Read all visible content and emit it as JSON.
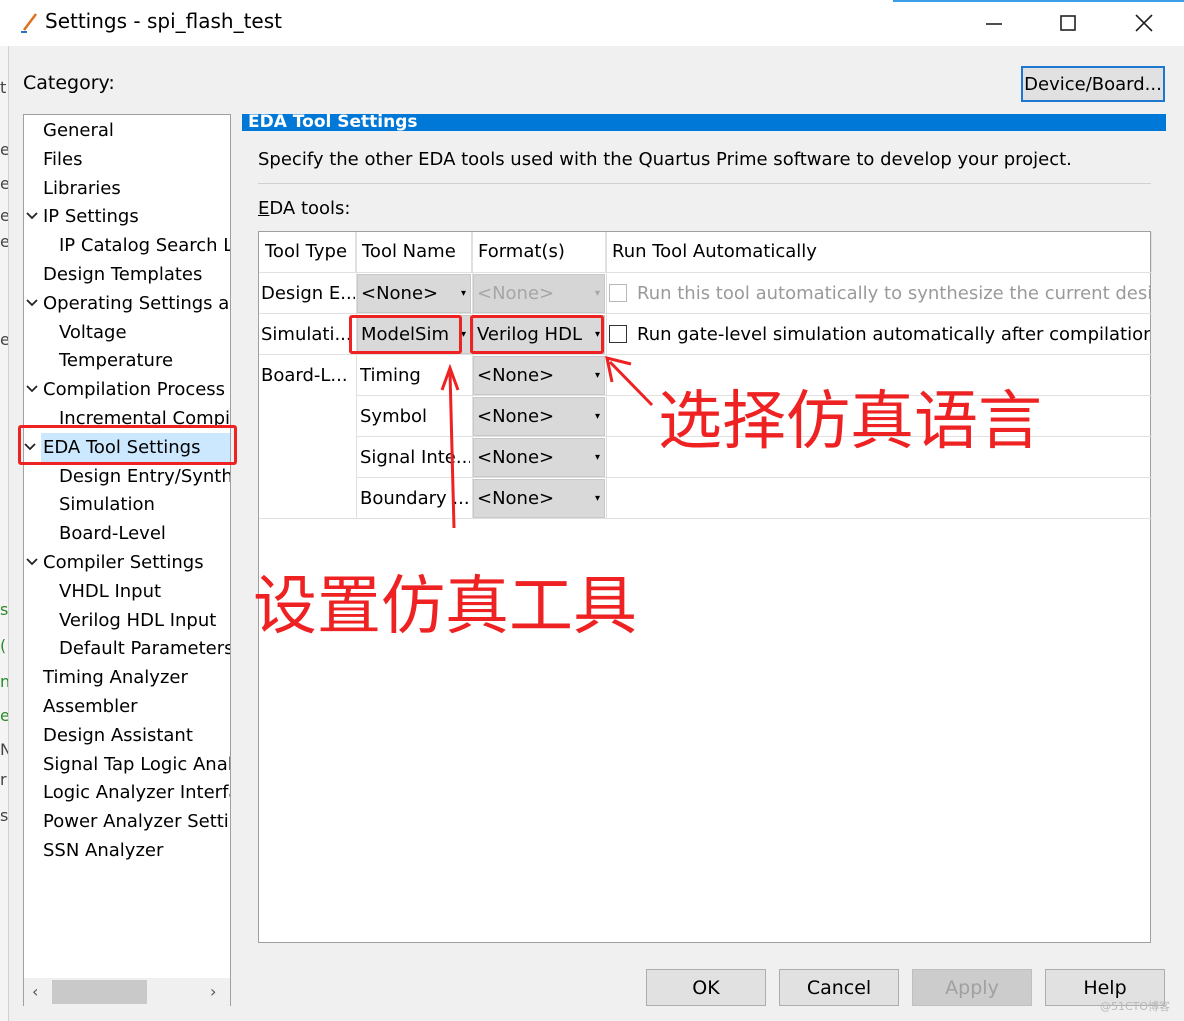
{
  "window": {
    "title": "Settings - spi_flash_test",
    "controls": [
      "minimize-icon",
      "maximize-icon",
      "close-icon"
    ]
  },
  "left_strip_chars": [
    "t",
    "e",
    "e",
    "e",
    "e",
    "e",
    "s",
    "(",
    "n",
    "e",
    "N",
    "r",
    "s"
  ],
  "category_label": "Category:",
  "device_button": "Device/Board...",
  "tree": {
    "items": [
      {
        "label": "General",
        "level": 0
      },
      {
        "label": "Files",
        "level": 0
      },
      {
        "label": "Libraries",
        "level": 0
      },
      {
        "label": "IP Settings",
        "level": 0,
        "expanded": true
      },
      {
        "label": "IP Catalog Search Locations",
        "level": 1
      },
      {
        "label": "Design Templates",
        "level": 0
      },
      {
        "label": "Operating Settings and Conditions",
        "level": 0,
        "expanded": true
      },
      {
        "label": "Voltage",
        "level": 1
      },
      {
        "label": "Temperature",
        "level": 1
      },
      {
        "label": "Compilation Process Settings",
        "level": 0,
        "expanded": true
      },
      {
        "label": "Incremental Compilation",
        "level": 1
      },
      {
        "label": "EDA Tool Settings",
        "level": 0,
        "expanded": true,
        "selected": true
      },
      {
        "label": "Design Entry/Synthesis",
        "level": 1
      },
      {
        "label": "Simulation",
        "level": 1
      },
      {
        "label": "Board-Level",
        "level": 1
      },
      {
        "label": "Compiler Settings",
        "level": 0,
        "expanded": true
      },
      {
        "label": "VHDL Input",
        "level": 1
      },
      {
        "label": "Verilog HDL Input",
        "level": 1
      },
      {
        "label": "Default Parameters",
        "level": 1
      },
      {
        "label": "Timing Analyzer",
        "level": 0
      },
      {
        "label": "Assembler",
        "level": 0
      },
      {
        "label": "Design Assistant",
        "level": 0
      },
      {
        "label": "Signal Tap Logic Analyzer",
        "level": 0
      },
      {
        "label": "Logic Analyzer Interface",
        "level": 0
      },
      {
        "label": "Power Analyzer Settings",
        "level": 0
      },
      {
        "label": "SSN Analyzer",
        "level": 0
      }
    ]
  },
  "panel": {
    "header": "EDA Tool Settings",
    "description": "Specify the other EDA tools used with the Quartus Prime software to develop your project.",
    "eda_label_prefix": "E",
    "eda_label_rest": "DA tools:"
  },
  "table": {
    "columns": [
      "Tool Type",
      "Tool Name",
      "Format(s)",
      "Run Tool Automatically"
    ],
    "rows": [
      {
        "type": "Design E...",
        "name": "<None>",
        "format": "<None>",
        "format_disabled": true,
        "check_label": "Run this tool automatically to synthesize the current design",
        "check_disabled": true
      },
      {
        "type": "Simulati...",
        "name": "ModelSim",
        "format": "Verilog HDL",
        "check_label": "Run gate-level simulation automatically after compilation"
      },
      {
        "type": "Board-L...",
        "name": "Timing",
        "format": "<None>"
      },
      {
        "type": "",
        "name": "Symbol",
        "format": "<None>"
      },
      {
        "type": "",
        "name": "Signal Inte...",
        "format": "<None>"
      },
      {
        "type": "",
        "name": "Boundary ...",
        "format": "<None>"
      }
    ]
  },
  "buttons": {
    "ok": "OK",
    "cancel": "Cancel",
    "apply": "Apply",
    "help": "Help"
  },
  "annotations": {
    "select_language": "选择仿真语言",
    "set_tool": "设置仿真工具",
    "color": "#ee2222"
  },
  "watermark": "@51CTO博客"
}
